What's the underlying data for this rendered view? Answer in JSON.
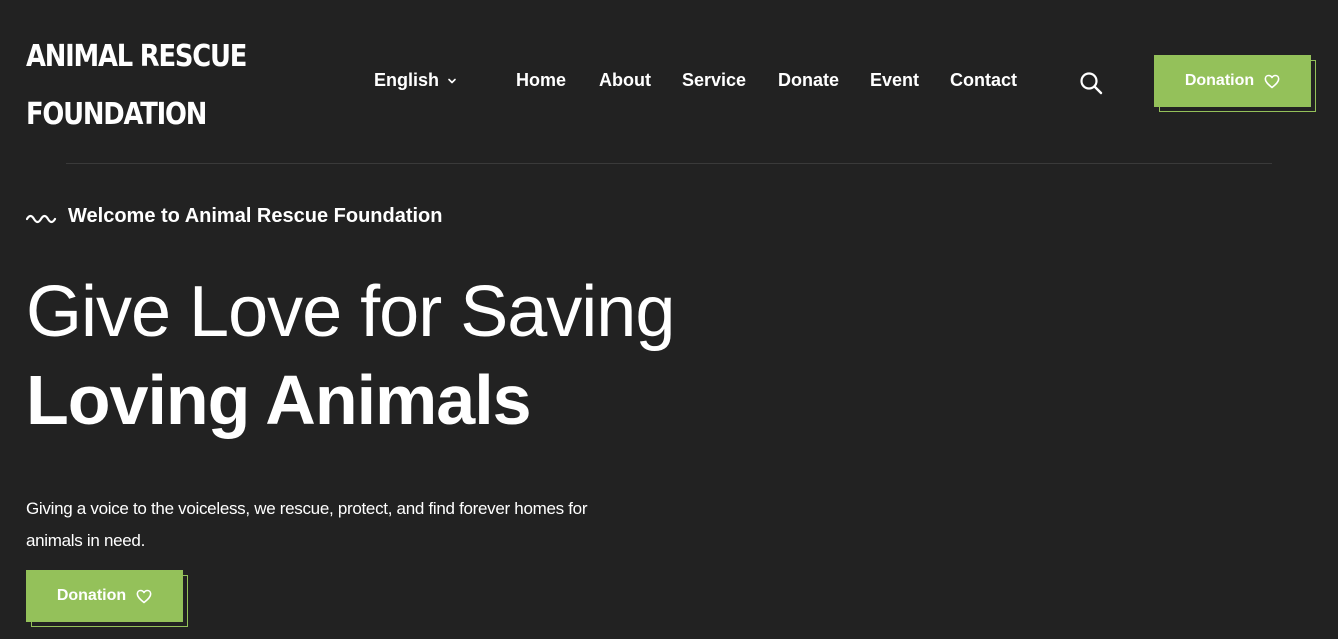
{
  "logo": {
    "line1": "ANIMAL RESCUE",
    "line2": "FOUNDATION"
  },
  "language": {
    "selected": "English",
    "icon": "chevron-down-icon"
  },
  "nav": {
    "items": [
      {
        "label": "Home"
      },
      {
        "label": "About"
      },
      {
        "label": "Service"
      },
      {
        "label": "Donate"
      },
      {
        "label": "Event"
      },
      {
        "label": "Contact"
      }
    ]
  },
  "header": {
    "search_icon": "search-icon",
    "donation_label": "Donation",
    "donation_icon": "heart-icon"
  },
  "hero": {
    "welcome": "Welcome to Animal Rescue Foundation",
    "welcome_icon": "wave-icon",
    "title_line1": "Give Love for Saving",
    "title_line2": "Loving Animals",
    "description": "Giving a voice to the voiceless, we rescue, protect, and find forever homes for animals in need.",
    "donation_label": "Donation",
    "donation_icon": "heart-icon"
  },
  "colors": {
    "background": "#222222",
    "accent": "#94c15a",
    "text": "#ffffff",
    "divider": "#3a3a3a"
  }
}
